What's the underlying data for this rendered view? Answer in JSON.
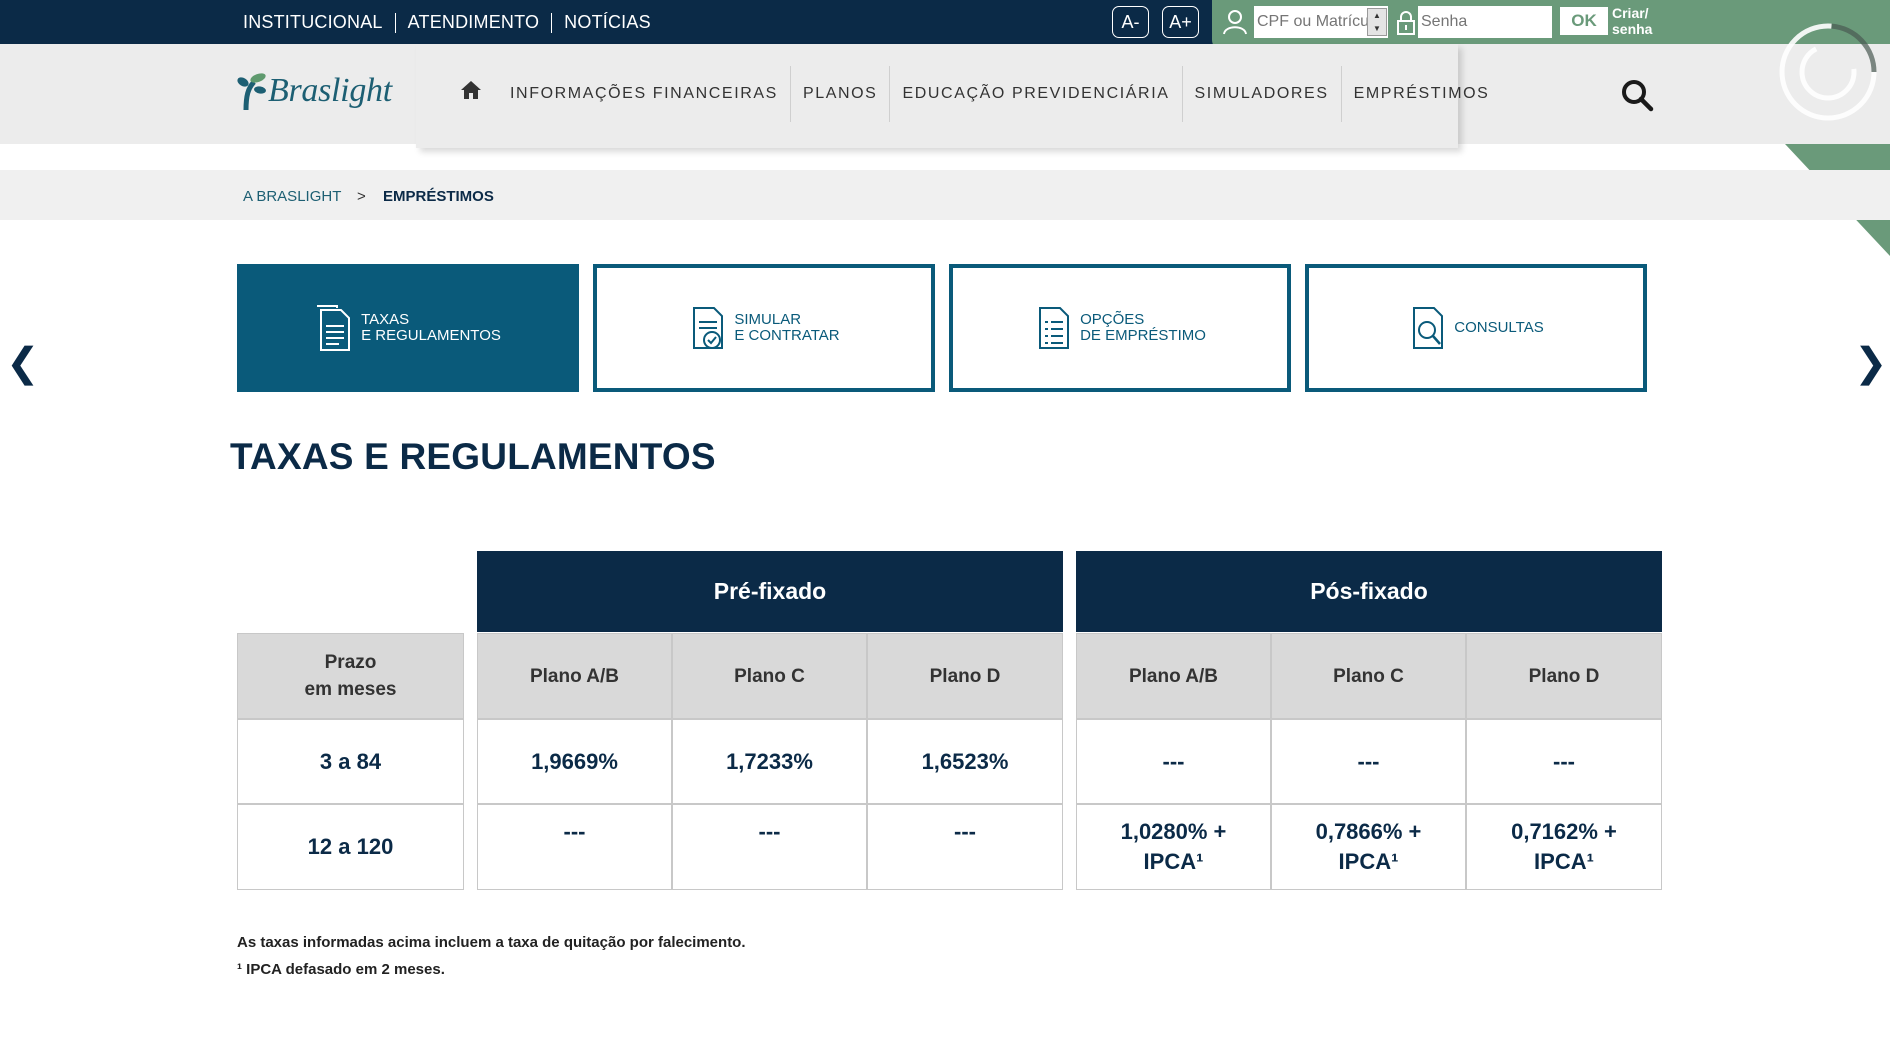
{
  "topbar": {
    "links": [
      "INSTITUCIONAL",
      "ATENDIMENTO",
      "NOTÍCIAS"
    ],
    "font_decrease": "A-",
    "font_increase": "A+"
  },
  "login": {
    "cpf_placeholder": "CPF ou Matrícula",
    "senha_placeholder": "Senha",
    "ok_label": "OK",
    "criar_label_1": "Criar/",
    "criar_label_2": "senha"
  },
  "header": {
    "logo_text": "Braslight",
    "nav": [
      "INFORMAÇÕES FINANCEIRAS",
      "PLANOS",
      "EDUCAÇÃO PREVIDENCIÁRIA",
      "SIMULADORES",
      "EMPRÉSTIMOS"
    ]
  },
  "breadcrumb": {
    "home": "A BRASLIGHT",
    "separator": ">",
    "current": "EMPRÉSTIMOS"
  },
  "carousel": {
    "prev": "❮",
    "next": "❯",
    "tabs": [
      {
        "line1": "TAXAS",
        "line2": "E REGULAMENTOS",
        "icon": "document-icon",
        "active": true
      },
      {
        "line1": "SIMULAR",
        "line2": "E CONTRATAR",
        "icon": "document-check-icon",
        "active": false
      },
      {
        "line1": "OPÇÕES",
        "line2": "DE EMPRÉSTIMO",
        "icon": "document-list-icon",
        "active": false
      },
      {
        "line1": "CONSULTAS",
        "line2": "",
        "icon": "document-search-icon",
        "active": false
      }
    ]
  },
  "page_title": "TAXAS E REGULAMENTOS",
  "table": {
    "groups": [
      "Pré-fixado",
      "Pós-fixado"
    ],
    "prazo_header_1": "Prazo",
    "prazo_header_2": "em meses",
    "plan_headers": [
      "Plano A/B",
      "Plano C",
      "Plano D",
      "Plano A/B",
      "Plano C",
      "Plano D"
    ],
    "rows": [
      {
        "prazo": "3 a 84",
        "values": [
          [
            "1,9669%"
          ],
          [
            "1,7233%"
          ],
          [
            "1,6523%"
          ],
          [
            "---"
          ],
          [
            "---"
          ],
          [
            "---"
          ]
        ]
      },
      {
        "prazo": "12 a 120",
        "values": [
          [
            "---"
          ],
          [
            "---"
          ],
          [
            "---"
          ],
          [
            "1,0280% +",
            "IPCA¹"
          ],
          [
            "0,7866% +",
            "IPCA¹"
          ],
          [
            "0,7162% +",
            "IPCA¹"
          ]
        ]
      }
    ]
  },
  "notes": [
    "As taxas informadas acima incluem a taxa de quitação por falecimento.",
    "¹ IPCA defasado em 2 meses."
  ],
  "colors": {
    "navy": "#0b2a47",
    "teal": "#0a5a7a",
    "green": "#6a9a7a"
  }
}
